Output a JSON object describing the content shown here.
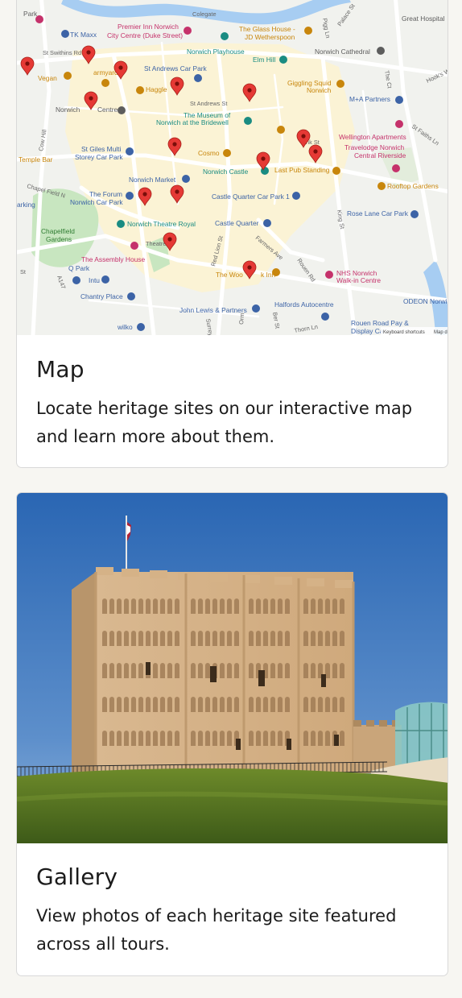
{
  "map_card": {
    "title": "Map",
    "description": "Locate heritage sites on our interactive map and learn more about them.",
    "map": {
      "attribution": "Keyboard shortcuts",
      "attribution_2": "Map d",
      "labels": [
        {
          "text": "Park",
          "color": "#5d5d5d"
        },
        {
          "text": "TK Maxx",
          "color": "#3c63a6"
        },
        {
          "text": "Premier Inn Norwich",
          "color": "#c5326b"
        },
        {
          "text": "City Centre (Duke Street)",
          "color": "#c5326b"
        },
        {
          "text": "Colegate",
          "color": "#666666"
        },
        {
          "text": "The Glass House -",
          "color": "#c8860c"
        },
        {
          "text": "JD Wetherspoon",
          "color": "#c8860c"
        },
        {
          "text": "Great Hospital",
          "color": "#5d5d5d"
        },
        {
          "text": "Norwich Playhouse",
          "color": "#1a8c82"
        },
        {
          "text": "Norwich Cathedral",
          "color": "#5d5d5d"
        },
        {
          "text": "Elm Hill",
          "color": "#1a8c82"
        },
        {
          "text": "St Swithins Rd",
          "color": "#666666"
        },
        {
          "text": "St Andrews Car Park",
          "color": "#3c63a6"
        },
        {
          "text": "Giggling Squid",
          "color": "#c8860c"
        },
        {
          "text": "Norwich",
          "color": "#c8860c"
        },
        {
          "text": "Vegan",
          "color": "#c8860c"
        },
        {
          "text": "armyard",
          "color": "#c8860c"
        },
        {
          "text": "Haggle",
          "color": "#c8860c"
        },
        {
          "text": "M+A Partners",
          "color": "#3c63a6"
        },
        {
          "text": "St Andrews St",
          "color": "#666666"
        },
        {
          "text": "Norwich",
          "color": "#5d5d5d"
        },
        {
          "text": "Centre",
          "color": "#5d5d5d"
        },
        {
          "text": "The Museum of",
          "color": "#1a8c82"
        },
        {
          "text": "Norwich at the Bridewell",
          "color": "#1a8c82"
        },
        {
          "text": "Wellington Apartments",
          "color": "#c5326b"
        },
        {
          "text": "Travelodge Norwich",
          "color": "#c5326b"
        },
        {
          "text": "Central Riverside",
          "color": "#c5326b"
        },
        {
          "text": "St Giles Multi",
          "color": "#3c63a6"
        },
        {
          "text": "Storey Car Park",
          "color": "#3c63a6"
        },
        {
          "text": "Cosmo",
          "color": "#c8860c"
        },
        {
          "text": "Temple Bar",
          "color": "#c8860c"
        },
        {
          "text": "Norwich Market",
          "color": "#3c63a6"
        },
        {
          "text": "Norwich Castle",
          "color": "#1a8c82"
        },
        {
          "text": "Last Pub Standing",
          "color": "#c8860c"
        },
        {
          "text": "Rooftop Gardens",
          "color": "#c8860c"
        },
        {
          "text": "The Forum",
          "color": "#3c63a6"
        },
        {
          "text": "Norwich Car Park",
          "color": "#3c63a6"
        },
        {
          "text": "Castle Quarter Car Park 1",
          "color": "#3c63a6"
        },
        {
          "text": "Rose Lane Car Park",
          "color": "#3c63a6"
        },
        {
          "text": "Norwich Theatre Royal",
          "color": "#1a8c82"
        },
        {
          "text": "Castle Quarter",
          "color": "#3c63a6"
        },
        {
          "text": "Chapelfield",
          "color": "#2f7d32"
        },
        {
          "text": "Gardens",
          "color": "#2f7d32"
        },
        {
          "text": "The Assembly House",
          "color": "#c5326b"
        },
        {
          "text": "NHS Norwich",
          "color": "#c5326b"
        },
        {
          "text": "Walk-in Centre",
          "color": "#c5326b"
        },
        {
          "text": "The Woo",
          "color": "#c8860c"
        },
        {
          "text": "k Inn",
          "color": "#c8860c"
        },
        {
          "text": "Intu",
          "color": "#3c63a6"
        },
        {
          "text": "Chantry Place",
          "color": "#3c63a6"
        },
        {
          "text": "Halfords Autocentre",
          "color": "#3c63a6"
        },
        {
          "text": "ODEON Norwic",
          "color": "#3c63a6"
        },
        {
          "text": "John Lewis & Partners",
          "color": "#3c63a6"
        },
        {
          "text": "Rouen Road Pay &",
          "color": "#3c63a6"
        },
        {
          "text": "Display Ca",
          "color": "#3c63a6"
        },
        {
          "text": "wilko",
          "color": "#3c63a6"
        },
        {
          "text": "Q Park",
          "color": "#3c63a6"
        },
        {
          "text": "arking",
          "color": "#3c63a6"
        },
        {
          "text": "Theatre",
          "color": "#666666"
        },
        {
          "text": "Cow Hill",
          "color": "#666666"
        },
        {
          "text": "Chapel Field N",
          "color": "#666666"
        },
        {
          "text": "A147",
          "color": "#666666"
        },
        {
          "text": "Pigg Ln",
          "color": "#666666"
        },
        {
          "text": "Palace St",
          "color": "#666666"
        },
        {
          "text": "Hook's Wa",
          "color": "#666666"
        },
        {
          "text": "St Faiths Ln",
          "color": "#666666"
        },
        {
          "text": "nk St",
          "color": "#666666"
        },
        {
          "text": "King St",
          "color": "#666666"
        },
        {
          "text": "The Ct",
          "color": "#666666"
        },
        {
          "text": "Red Lion St",
          "color": "#666666"
        },
        {
          "text": "Farmers Ave",
          "color": "#666666"
        },
        {
          "text": "Rouen Rd",
          "color": "#666666"
        },
        {
          "text": "Ber St",
          "color": "#666666"
        },
        {
          "text": "Thorn Ln",
          "color": "#666666"
        },
        {
          "text": "Surrey",
          "color": "#666666"
        },
        {
          "text": "Orm",
          "color": "#666666"
        },
        {
          "text": "St",
          "color": "#666666"
        }
      ],
      "marker_color": "#e53935",
      "water_color": "#a7cdf2",
      "park_color": "#c8e6c0",
      "centre_color": "#fbf3d5"
    }
  },
  "gallery_card": {
    "title": "Gallery",
    "description": "View photos of each heritage site featured across all tours.",
    "sky_color": "#2e6fb8",
    "stone_color": "#d7b48a",
    "grass_color": "#5c7a22"
  }
}
